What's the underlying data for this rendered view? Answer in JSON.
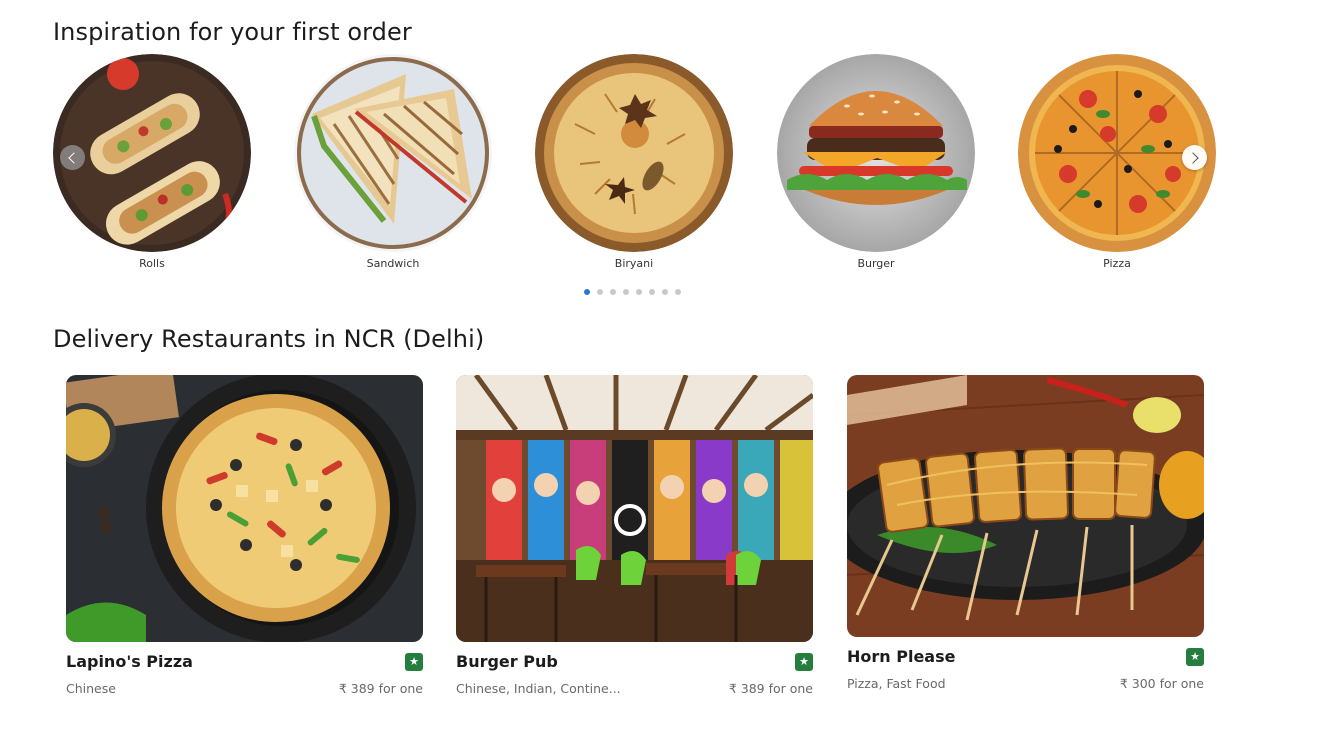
{
  "inspiration": {
    "title": "Inspiration for your first order",
    "categories": [
      {
        "label": "Rolls"
      },
      {
        "label": "Sandwich"
      },
      {
        "label": "Biryani"
      },
      {
        "label": "Burger"
      },
      {
        "label": "Pizza"
      }
    ],
    "carousel": {
      "total_pages": 8,
      "active_page": 1
    }
  },
  "delivery": {
    "title": "Delivery Restaurants in NCR (Delhi)",
    "restaurants": [
      {
        "name": "Lapino's Pizza",
        "cuisine": "Chinese",
        "price": "₹ 389 for one",
        "rating_icon": "star-icon"
      },
      {
        "name": "Burger Pub",
        "cuisine": "Chinese, Indian, Contine...",
        "price": "₹ 389 for one",
        "rating_icon": "star-icon"
      },
      {
        "name": "Horn Please",
        "cuisine": "Pizza, Fast Food",
        "price": "₹ 300 for one",
        "rating_icon": "star-icon"
      }
    ]
  },
  "colors": {
    "rating_badge": "#267e3e",
    "active_dot": "#2a77d8",
    "inactive_dot": "#c9c9c9"
  }
}
